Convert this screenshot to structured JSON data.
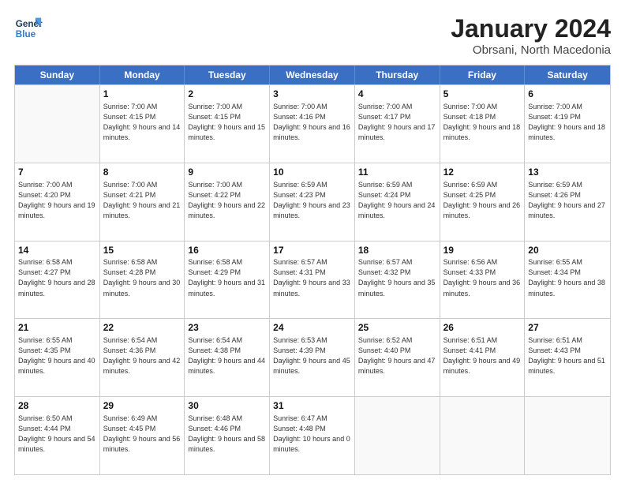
{
  "header": {
    "logo_line1": "General",
    "logo_line2": "Blue",
    "title": "January 2024",
    "subtitle": "Obrsani, North Macedonia"
  },
  "days_of_week": [
    "Sunday",
    "Monday",
    "Tuesday",
    "Wednesday",
    "Thursday",
    "Friday",
    "Saturday"
  ],
  "weeks": [
    [
      {
        "day": "",
        "empty": true
      },
      {
        "day": "1",
        "sunrise": "Sunrise: 7:00 AM",
        "sunset": "Sunset: 4:15 PM",
        "daylight": "Daylight: 9 hours and 14 minutes."
      },
      {
        "day": "2",
        "sunrise": "Sunrise: 7:00 AM",
        "sunset": "Sunset: 4:15 PM",
        "daylight": "Daylight: 9 hours and 15 minutes."
      },
      {
        "day": "3",
        "sunrise": "Sunrise: 7:00 AM",
        "sunset": "Sunset: 4:16 PM",
        "daylight": "Daylight: 9 hours and 16 minutes."
      },
      {
        "day": "4",
        "sunrise": "Sunrise: 7:00 AM",
        "sunset": "Sunset: 4:17 PM",
        "daylight": "Daylight: 9 hours and 17 minutes."
      },
      {
        "day": "5",
        "sunrise": "Sunrise: 7:00 AM",
        "sunset": "Sunset: 4:18 PM",
        "daylight": "Daylight: 9 hours and 18 minutes."
      },
      {
        "day": "6",
        "sunrise": "Sunrise: 7:00 AM",
        "sunset": "Sunset: 4:19 PM",
        "daylight": "Daylight: 9 hours and 18 minutes."
      }
    ],
    [
      {
        "day": "7",
        "sunrise": "Sunrise: 7:00 AM",
        "sunset": "Sunset: 4:20 PM",
        "daylight": "Daylight: 9 hours and 19 minutes."
      },
      {
        "day": "8",
        "sunrise": "Sunrise: 7:00 AM",
        "sunset": "Sunset: 4:21 PM",
        "daylight": "Daylight: 9 hours and 21 minutes."
      },
      {
        "day": "9",
        "sunrise": "Sunrise: 7:00 AM",
        "sunset": "Sunset: 4:22 PM",
        "daylight": "Daylight: 9 hours and 22 minutes."
      },
      {
        "day": "10",
        "sunrise": "Sunrise: 6:59 AM",
        "sunset": "Sunset: 4:23 PM",
        "daylight": "Daylight: 9 hours and 23 minutes."
      },
      {
        "day": "11",
        "sunrise": "Sunrise: 6:59 AM",
        "sunset": "Sunset: 4:24 PM",
        "daylight": "Daylight: 9 hours and 24 minutes."
      },
      {
        "day": "12",
        "sunrise": "Sunrise: 6:59 AM",
        "sunset": "Sunset: 4:25 PM",
        "daylight": "Daylight: 9 hours and 26 minutes."
      },
      {
        "day": "13",
        "sunrise": "Sunrise: 6:59 AM",
        "sunset": "Sunset: 4:26 PM",
        "daylight": "Daylight: 9 hours and 27 minutes."
      }
    ],
    [
      {
        "day": "14",
        "sunrise": "Sunrise: 6:58 AM",
        "sunset": "Sunset: 4:27 PM",
        "daylight": "Daylight: 9 hours and 28 minutes."
      },
      {
        "day": "15",
        "sunrise": "Sunrise: 6:58 AM",
        "sunset": "Sunset: 4:28 PM",
        "daylight": "Daylight: 9 hours and 30 minutes."
      },
      {
        "day": "16",
        "sunrise": "Sunrise: 6:58 AM",
        "sunset": "Sunset: 4:29 PM",
        "daylight": "Daylight: 9 hours and 31 minutes."
      },
      {
        "day": "17",
        "sunrise": "Sunrise: 6:57 AM",
        "sunset": "Sunset: 4:31 PM",
        "daylight": "Daylight: 9 hours and 33 minutes."
      },
      {
        "day": "18",
        "sunrise": "Sunrise: 6:57 AM",
        "sunset": "Sunset: 4:32 PM",
        "daylight": "Daylight: 9 hours and 35 minutes."
      },
      {
        "day": "19",
        "sunrise": "Sunrise: 6:56 AM",
        "sunset": "Sunset: 4:33 PM",
        "daylight": "Daylight: 9 hours and 36 minutes."
      },
      {
        "day": "20",
        "sunrise": "Sunrise: 6:55 AM",
        "sunset": "Sunset: 4:34 PM",
        "daylight": "Daylight: 9 hours and 38 minutes."
      }
    ],
    [
      {
        "day": "21",
        "sunrise": "Sunrise: 6:55 AM",
        "sunset": "Sunset: 4:35 PM",
        "daylight": "Daylight: 9 hours and 40 minutes."
      },
      {
        "day": "22",
        "sunrise": "Sunrise: 6:54 AM",
        "sunset": "Sunset: 4:36 PM",
        "daylight": "Daylight: 9 hours and 42 minutes."
      },
      {
        "day": "23",
        "sunrise": "Sunrise: 6:54 AM",
        "sunset": "Sunset: 4:38 PM",
        "daylight": "Daylight: 9 hours and 44 minutes."
      },
      {
        "day": "24",
        "sunrise": "Sunrise: 6:53 AM",
        "sunset": "Sunset: 4:39 PM",
        "daylight": "Daylight: 9 hours and 45 minutes."
      },
      {
        "day": "25",
        "sunrise": "Sunrise: 6:52 AM",
        "sunset": "Sunset: 4:40 PM",
        "daylight": "Daylight: 9 hours and 47 minutes."
      },
      {
        "day": "26",
        "sunrise": "Sunrise: 6:51 AM",
        "sunset": "Sunset: 4:41 PM",
        "daylight": "Daylight: 9 hours and 49 minutes."
      },
      {
        "day": "27",
        "sunrise": "Sunrise: 6:51 AM",
        "sunset": "Sunset: 4:43 PM",
        "daylight": "Daylight: 9 hours and 51 minutes."
      }
    ],
    [
      {
        "day": "28",
        "sunrise": "Sunrise: 6:50 AM",
        "sunset": "Sunset: 4:44 PM",
        "daylight": "Daylight: 9 hours and 54 minutes."
      },
      {
        "day": "29",
        "sunrise": "Sunrise: 6:49 AM",
        "sunset": "Sunset: 4:45 PM",
        "daylight": "Daylight: 9 hours and 56 minutes."
      },
      {
        "day": "30",
        "sunrise": "Sunrise: 6:48 AM",
        "sunset": "Sunset: 4:46 PM",
        "daylight": "Daylight: 9 hours and 58 minutes."
      },
      {
        "day": "31",
        "sunrise": "Sunrise: 6:47 AM",
        "sunset": "Sunset: 4:48 PM",
        "daylight": "Daylight: 10 hours and 0 minutes."
      },
      {
        "day": "",
        "empty": true
      },
      {
        "day": "",
        "empty": true
      },
      {
        "day": "",
        "empty": true
      }
    ]
  ]
}
